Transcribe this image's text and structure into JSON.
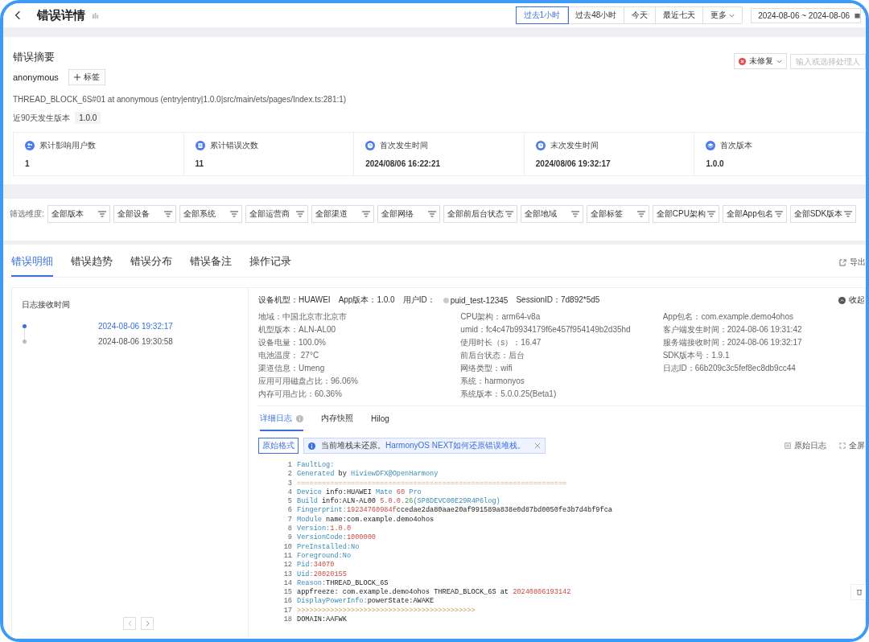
{
  "header": {
    "title": "错误详情",
    "ranges": [
      {
        "label": "过去1小时",
        "selected": true
      },
      {
        "label": "过去48小时",
        "selected": false
      },
      {
        "label": "今天",
        "selected": false
      },
      {
        "label": "最近七天",
        "selected": false
      },
      {
        "label": "更多",
        "selected": false
      }
    ],
    "date_range": "2024-08-06 ~ 2024-08-06"
  },
  "summary": {
    "title": "错误摘要",
    "status": "未修复",
    "assignee_placeholder": "输入或选择处理人",
    "name": "anonymous",
    "tag_button": "标签",
    "description": "THREAD_BLOCK_6S#01 at anonymous (entry|entry|1.0.0|src/main/ets/pages/Index.ts:281:1)",
    "versions_label": "近90天发生版本",
    "versions": [
      "1.0.0"
    ],
    "stats": [
      {
        "label": "累计影响用户数",
        "value": "1",
        "kind": "users"
      },
      {
        "label": "累计错误次数",
        "value": "11",
        "kind": "doc"
      },
      {
        "label": "首次发生时间",
        "value": "2024/08/06 16:22:21",
        "kind": "clock"
      },
      {
        "label": "末次发生时间",
        "value": "2024/08/06 19:32:17",
        "kind": "clock"
      },
      {
        "label": "首次版本",
        "value": "1.0.0",
        "kind": "layers"
      }
    ]
  },
  "filters": {
    "label": "筛选维度:",
    "items": [
      "全部版本",
      "全部设备",
      "全部系统",
      "全部运营商",
      "全部渠道",
      "全部网络",
      "全部前后台状态",
      "全部地域",
      "全部标签",
      "全部CPU架构",
      "全部App包名",
      "全部SDK版本"
    ]
  },
  "tabs": [
    {
      "label": "错误明细",
      "selected": true
    },
    {
      "label": "错误趋势",
      "selected": false
    },
    {
      "label": "错误分布",
      "selected": false
    },
    {
      "label": "错误备注",
      "selected": false
    },
    {
      "label": "操作记录",
      "selected": false
    }
  ],
  "export": "导出",
  "log_times": {
    "title": "日志接收时间",
    "items": [
      {
        "time": "2024-08-06 19:32:17",
        "selected": true
      },
      {
        "time": "2024-08-06 19:30:58",
        "selected": false
      }
    ]
  },
  "device": {
    "top": [
      "设备机型：HUAWEI",
      "App版本：1.0.0",
      "用户ID：",
      "puid_test-12345",
      "SessionID：7d892*5d5"
    ],
    "collapse": "收起",
    "columns": [
      [
        "地域：中国北京市北京市",
        "机型版本：ALN-AL00",
        "设备电量：100.0%",
        "电池温度： 27°C",
        "渠道信息：Umeng",
        "应用可用磁盘占比：96.06%",
        "内存可用占比：60.36%"
      ],
      [
        "CPU架构：arm64-v8a",
        "umid：fc4c47b9934179f6e457f954149b2d35hd",
        "使用时长（s）：16.47",
        "前后台状态：后台",
        "网络类型：wifi",
        "系统：harmonyos",
        "系统版本：5.0.0.25(Beta1)"
      ],
      [
        "App包名：com.example.demo4ohos",
        "客户端发生时间：2024-08-06 19:31:42",
        "服务端接收时间：2024-08-06 19:32:17",
        "SDK版本号：1.9.1",
        "日志ID：66b209c3c5fef8ec8db9cc44"
      ]
    ]
  },
  "log_tabs": [
    {
      "label": "详细日志",
      "selected": true
    },
    {
      "label": "内存快照",
      "selected": false
    },
    {
      "label": "Hilog",
      "selected": false
    }
  ],
  "format_button": "原始格式",
  "notice": "当前堆栈未还原。",
  "notice_link": "HarmonyOS NEXT如何还原错误堆栈。",
  "raw_log": "原始日志",
  "fullscreen": "全屏",
  "log": [
    {
      "n": "1",
      "segs": [
        {
          "t": "FaultLog:",
          "kind": "key"
        }
      ]
    },
    {
      "n": "2",
      "segs": [
        {
          "t": "Generated",
          "kind": "key"
        },
        {
          "t": " by ",
          "kind": "text"
        },
        {
          "t": "HiviewDFX@OpenHarmony",
          "kind": "key"
        }
      ]
    },
    {
      "n": "3",
      "segs": [
        {
          "t": "=================================================================",
          "kind": "rule"
        }
      ]
    },
    {
      "n": "4",
      "segs": [
        {
          "t": "Device",
          "kind": "key"
        },
        {
          "t": " info:HUAWEI ",
          "kind": "text"
        },
        {
          "t": "Mate ",
          "kind": "key"
        },
        {
          "t": "60",
          "kind": "num"
        },
        {
          "t": " Pro",
          "kind": "key"
        }
      ]
    },
    {
      "n": "5",
      "segs": [
        {
          "t": "Build",
          "kind": "key"
        },
        {
          "t": " info:ALN-AL00 ",
          "kind": "text"
        },
        {
          "t": "5.0.0.",
          "kind": "num"
        },
        {
          "t": "26",
          "kind": "green"
        },
        {
          "t": "(SP8DEVC00E29R4P6log)",
          "kind": "key"
        }
      ]
    },
    {
      "n": "6",
      "segs": [
        {
          "t": "Fingerprint:",
          "kind": "key"
        },
        {
          "t": "19234760984f",
          "kind": "num"
        },
        {
          "t": "ccedae2da80aae20af991589a838e0d87bd0050fe3b7d4bf9fca",
          "kind": "text"
        }
      ]
    },
    {
      "n": "7",
      "segs": [
        {
          "t": "Module",
          "kind": "key"
        },
        {
          "t": " name:com.example.demo4ohos",
          "kind": "text"
        }
      ]
    },
    {
      "n": "8",
      "segs": [
        {
          "t": "Version:",
          "kind": "key"
        },
        {
          "t": "1.0.0",
          "kind": "num"
        }
      ]
    },
    {
      "n": "9",
      "segs": [
        {
          "t": "VersionCode:",
          "kind": "key"
        },
        {
          "t": "1000000",
          "kind": "num"
        }
      ]
    },
    {
      "n": "10",
      "segs": [
        {
          "t": "PreInstalled:No",
          "kind": "key"
        }
      ]
    },
    {
      "n": "11",
      "segs": [
        {
          "t": "Foreground:No",
          "kind": "key"
        }
      ]
    },
    {
      "n": "12",
      "segs": [
        {
          "t": "Pid:",
          "kind": "key"
        },
        {
          "t": "34070",
          "kind": "num"
        }
      ]
    },
    {
      "n": "13",
      "segs": [
        {
          "t": "Uid:",
          "kind": "key"
        },
        {
          "t": "20020155",
          "kind": "num"
        }
      ]
    },
    {
      "n": "14",
      "segs": [
        {
          "t": "Reason:",
          "kind": "key"
        },
        {
          "t": "THREAD_BLOCK_6S",
          "kind": "text"
        }
      ]
    },
    {
      "n": "15",
      "segs": [
        {
          "t": "appfreeze: com.example.demo4ohos THREAD_BLOCK_6S at ",
          "kind": "text"
        },
        {
          "t": "20240806193142",
          "kind": "num"
        }
      ]
    },
    {
      "n": "16",
      "segs": [
        {
          "t": "DisplayPowerInfo:",
          "kind": "key"
        },
        {
          "t": "powerState:AWAKE",
          "kind": "text"
        }
      ]
    },
    {
      "n": "17",
      "segs": [
        {
          "t": ">>>>>>>>>>>>>>>>>>>>>>>>>>>>>>>>>>>>>>>>>>>",
          "kind": "rule"
        }
      ]
    },
    {
      "n": "18",
      "segs": [
        {
          "t": "DOMAIN:AAFWK",
          "kind": "text"
        }
      ]
    }
  ]
}
